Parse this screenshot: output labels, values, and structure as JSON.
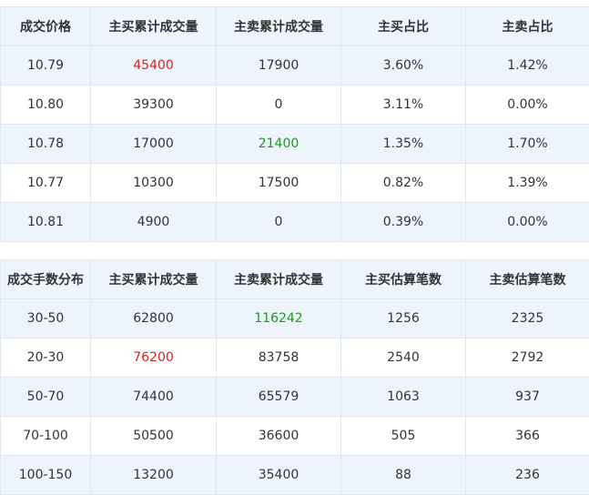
{
  "price_table": {
    "headers": [
      "成交价格",
      "主买累计成交量",
      "主卖累计成交量",
      "主买占比",
      "主卖占比"
    ],
    "rows": [
      {
        "cells": [
          "10.79",
          "45400",
          "17900",
          "3.60%",
          "1.42%"
        ],
        "highlight": {
          "col": 1,
          "color": "red"
        }
      },
      {
        "cells": [
          "10.80",
          "39300",
          "0",
          "3.11%",
          "0.00%"
        ],
        "highlight": null
      },
      {
        "cells": [
          "10.78",
          "17000",
          "21400",
          "1.35%",
          "1.70%"
        ],
        "highlight": {
          "col": 2,
          "color": "green"
        }
      },
      {
        "cells": [
          "10.77",
          "10300",
          "17500",
          "0.82%",
          "1.39%"
        ],
        "highlight": null
      },
      {
        "cells": [
          "10.81",
          "4900",
          "0",
          "0.39%",
          "0.00%"
        ],
        "highlight": null
      }
    ]
  },
  "lot_table": {
    "headers": [
      "成交手数分布",
      "主买累计成交量",
      "主卖累计成交量",
      "主买估算笔数",
      "主卖估算笔数"
    ],
    "rows": [
      {
        "cells": [
          "30-50",
          "62800",
          "116242",
          "1256",
          "2325"
        ],
        "highlight": {
          "col": 2,
          "color": "green"
        }
      },
      {
        "cells": [
          "20-30",
          "76200",
          "83758",
          "2540",
          "2792"
        ],
        "highlight": {
          "col": 1,
          "color": "red"
        }
      },
      {
        "cells": [
          "50-70",
          "74400",
          "65579",
          "1063",
          "937"
        ],
        "highlight": null
      },
      {
        "cells": [
          "70-100",
          "50500",
          "36600",
          "505",
          "366"
        ],
        "highlight": null
      },
      {
        "cells": [
          "100-150",
          "13200",
          "35400",
          "88",
          "236"
        ],
        "highlight": null
      }
    ]
  },
  "colors": {
    "red": "#e0201c",
    "green": "#1a9a1a",
    "row_alt": "#eef4fc",
    "border": "#dfe7f2"
  }
}
